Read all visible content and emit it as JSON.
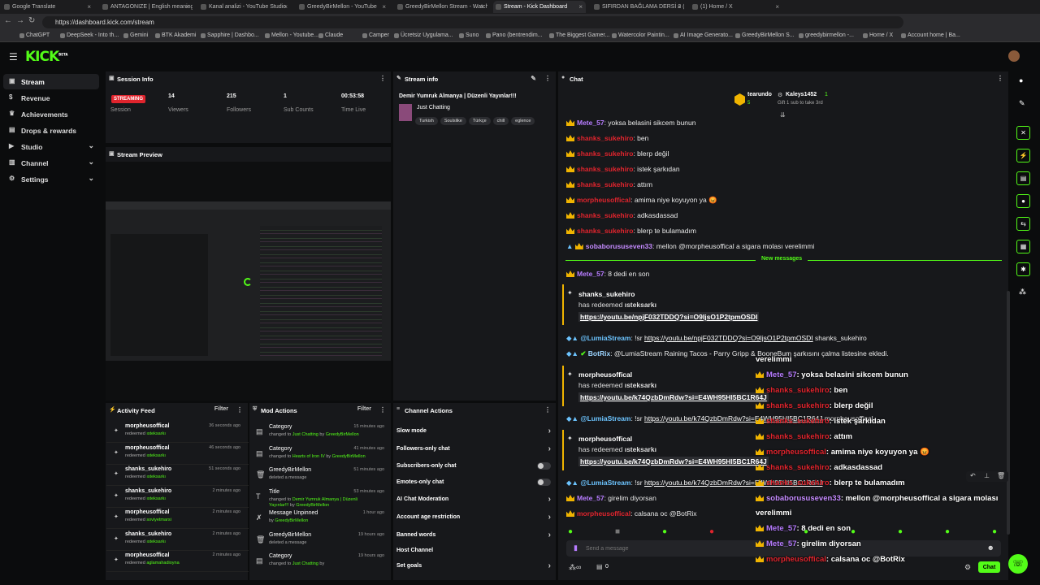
{
  "browser": {
    "tabs": [
      "Google Translate",
      "ANTAGONIZE | English meaning -",
      "Kanal analizi - YouTube Studio",
      "GreedyBirMellon - YouTube",
      "GreedyBirMellon Stream - Watch",
      "Stream - Kick Dashboard",
      "SIFIRDAN BAĞLAMA DERSİ 3 (Eh",
      "(1) Home / X"
    ],
    "url": "https://dashboard.kick.com/stream",
    "bookmarks": [
      "ChatGPT",
      "DeepSeek - Into th...",
      "Gemini",
      "BTK Akademi",
      "Sapphire | Dashbo...",
      "Mellon - Youtube...",
      "Claude",
      "Camper",
      "Ücretsiz Uygulama...",
      "Suno",
      "Pano (bentrendim...",
      "The Biggest Gamer...",
      "Watercolor Paintin...",
      "AI Image Generato...",
      "GreedyBirMellon S...",
      "greedybirmellon -...",
      "Home / X",
      "Account home | Ba..."
    ]
  },
  "logo": "KICK",
  "logo_sup": "BETA",
  "sidebar": [
    {
      "label": "Stream",
      "icon": "stream-icon"
    },
    {
      "label": "Revenue",
      "icon": "revenue-icon"
    },
    {
      "label": "Achievements",
      "icon": "trophy-icon"
    },
    {
      "label": "Drops & rewards",
      "icon": "gift-icon"
    },
    {
      "label": "Studio",
      "icon": "studio-icon"
    },
    {
      "label": "Channel",
      "icon": "channel-icon"
    },
    {
      "label": "Settings",
      "icon": "gear-icon"
    }
  ],
  "session": {
    "title": "Session Info",
    "status": "STREAMING",
    "status_label": "Session",
    "viewers": "14",
    "viewers_label": "Viewers",
    "followers": "215",
    "followers_label": "Followers",
    "subs": "1",
    "subs_label": "Sub Counts",
    "time": "00:53:58",
    "time_label": "Time Live"
  },
  "preview": {
    "title": "Stream Preview"
  },
  "streaminfo": {
    "title": "Stream info",
    "stream_title": "Demir Yumruk Almanya | Düzenli Yayınlar!!!",
    "category": "Just Chatting",
    "tags": [
      "Turkish",
      "Soulslike",
      "Türkçe",
      "chill",
      "eglence"
    ]
  },
  "activity": {
    "title": "Activity Feed",
    "filter": "Filter",
    "items": [
      {
        "user": "morpheusoffical",
        "action": "redeemed",
        "reward": "ısteksarkı",
        "time": "36 seconds ago"
      },
      {
        "user": "morpheusoffical",
        "action": "redeemed",
        "reward": "ısteksarkı",
        "time": "46 seconds ago"
      },
      {
        "user": "shanks_sukehiro",
        "action": "redeemed",
        "reward": "ısteksarkı",
        "time": "51 seconds ago"
      },
      {
        "user": "shanks_sukehiro",
        "action": "redeemed",
        "reward": "ısteksarkı",
        "time": "2 minutes ago"
      },
      {
        "user": "morpheusoffical",
        "action": "redeemed",
        "reward": "soviyetmarsi",
        "time": "2 minutes ago"
      },
      {
        "user": "shanks_sukehiro",
        "action": "redeemed",
        "reward": "ısteksarkı",
        "time": "2 minutes ago"
      },
      {
        "user": "morpheusoffical",
        "action": "redeemed",
        "reward": "aglamahadioyna",
        "time": "2 minutes ago"
      }
    ]
  },
  "mod": {
    "title": "Mod Actions",
    "filter": "Filter",
    "items": [
      {
        "head": "Category",
        "pre": "changed to",
        "val": "Just Chatting",
        "mid": "by",
        "by": "GreedyBirMellon",
        "time": "15 minutes ago",
        "icon": "category-icon"
      },
      {
        "head": "Category",
        "pre": "changed to",
        "val": "Hearts of Iron IV",
        "mid": "by",
        "by": "GreedyBirMellon",
        "time": "41 minutes ago",
        "icon": "category-icon"
      },
      {
        "head": "GreedyBirMellon",
        "pre": "deleted a message",
        "val": "",
        "mid": "",
        "by": "",
        "time": "51 minutes ago",
        "icon": "trash-icon"
      },
      {
        "head": "Title",
        "pre": "changed to",
        "val": "Demir Yumruk Almanya | Düzenli Yayınlar!!!",
        "mid": "by",
        "by": "GreedyBirMellon",
        "time": "53 minutes ago",
        "icon": "title-icon"
      },
      {
        "head": "Message Unpinned",
        "pre": "by",
        "val": "GreedyBirMellon",
        "mid": "",
        "by": "",
        "time": "1 hour ago",
        "icon": "pin-icon"
      },
      {
        "head": "GreedyBirMellon",
        "pre": "deleted a message",
        "val": "",
        "mid": "",
        "by": "",
        "time": "19 hours ago",
        "icon": "trash-icon"
      },
      {
        "head": "Category",
        "pre": "changed to",
        "val": "Just Chatting",
        "mid": "by",
        "by": "",
        "time": "19 hours ago",
        "icon": "category-icon"
      }
    ]
  },
  "channel_actions": {
    "title": "Channel Actions",
    "items": [
      "Slow mode",
      "Followers-only chat",
      "Subscribers-only chat",
      "Emotes-only chat",
      "AI Chat Moderation",
      "Account age restriction",
      "Banned words",
      "Host Channel",
      "Set goals"
    ]
  },
  "chat": {
    "title": "Chat",
    "top_gifter": "tearundo",
    "top_count": "5",
    "gifter2": "Kaleys1452",
    "gifter2_count": "1",
    "gift_note": "Gift 1 sub to take 3rd",
    "new_messages": "New messages",
    "lines": [
      {
        "u": "Mete_57",
        "c": "mgr",
        "m": ": yoksa belasini sikcem bunun"
      },
      {
        "u": "shanks_sukehiro",
        "c": "red",
        "m": ": ben"
      },
      {
        "u": "shanks_sukehiro",
        "c": "red",
        "m": ": blerp değil"
      },
      {
        "u": "shanks_sukehiro",
        "c": "red",
        "m": ": istek şarkıdan"
      },
      {
        "u": "shanks_sukehiro",
        "c": "red",
        "m": ": attım"
      },
      {
        "u": "morpheusoffical",
        "c": "red",
        "m": ": amima niye koyuyon ya 😡"
      },
      {
        "u": "shanks_sukehiro",
        "c": "red",
        "m": ": adkasdassad"
      },
      {
        "u": "shanks_sukehiro",
        "c": "red",
        "m": ": blerp te bulamadım"
      },
      {
        "u": "sobaborususeven33",
        "c": "pur",
        "m": ": mellon @morpheusoffical a sigara molası verelimmi"
      }
    ],
    "after": [
      {
        "u": "Mete_57",
        "c": "mgr",
        "m": ": 8 dedi en son"
      }
    ],
    "redeem1": {
      "user": "shanks_sukehiro",
      "text": "has redeemed",
      "reward": "ısteksarkı",
      "link": "https://youtu.be/npjF032TDDQ?si=O9IjsO1P2tpmOSDI"
    },
    "lumia1": {
      "u": "@LumiaStream",
      "pre": ": !sr ",
      "link": "https://youtu.be/npjF032TDDQ?si=O9IjsO1P2tpmOSDI",
      "post": " shanks_sukehiro"
    },
    "botrix": {
      "u": "BotRix",
      "m": ": @LumiaStream Raining Tacos - Parry Gripp & BooneBum şarkısını çalma listesine ekledi."
    },
    "redeem2": {
      "user": "morpheusoffical",
      "text": "has redeemed",
      "reward": "ısteksarkı",
      "link": "https://youtu.be/k74QzbDmRdw?si=E4WH95HI5BC1R64J"
    },
    "lumia2": {
      "u": "@LumiaStream",
      "pre": ": !sr ",
      "link": "https://youtu.be/k74QzbDmRdw?si=E4WH95HI5BC1R64J",
      "post": " morpheusoffical"
    },
    "redeem3": {
      "user": "morpheusoffical",
      "text": "has redeemed",
      "reward": "ısteksarkı",
      "link": "https://youtu.be/k74QzbDmRdw?si=E4WH95HI5BC1R64J"
    },
    "lumia3": {
      "u": "@LumiaStream",
      "pre": ": !sr ",
      "link": "https://youtu.be/k74QzbDmRdw?si=E4WH95HI5BC1R64J",
      "post": ""
    },
    "tail": [
      {
        "u": "Mete_57",
        "c": "mgr",
        "m": ": girelim diyorsan"
      },
      {
        "u": "morpheusoffical",
        "c": "red",
        "m": ": calsana oc @BotRix"
      }
    ],
    "placeholder": "Send a message",
    "user_count": "0",
    "send": "Chat"
  },
  "overlay": {
    "top": "verelimmi",
    "lines": [
      {
        "u": "Mete_57",
        "c": "mgr",
        "m": ": yoksa belasini sikcem bunun"
      },
      {
        "u": "shanks_sukehiro",
        "c": "red",
        "m": ": ben"
      },
      {
        "u": "shanks_sukehiro",
        "c": "red",
        "m": ": blerp değil"
      },
      {
        "u": "shanks_sukehiro",
        "c": "red",
        "m": ": istek şarkıdan"
      },
      {
        "u": "shanks_sukehiro",
        "c": "red",
        "m": ": attım"
      },
      {
        "u": "morpheusoffical",
        "c": "red",
        "m": ": amima niye koyuyon ya 😡"
      },
      {
        "u": "shanks_sukehiro",
        "c": "red",
        "m": ": adkasdassad"
      },
      {
        "u": "shanks_sukehiro",
        "c": "red",
        "m": ": blerp te bulamadım"
      },
      {
        "u": "sobaborususeven33",
        "c": "pur",
        "m": ": mellon @morpheusoffical a sigara molası"
      },
      {
        "u": "",
        "c": "",
        "m": "verelimmi"
      },
      {
        "u": "Mete_57",
        "c": "mgr",
        "m": ": 8 dedi en son"
      },
      {
        "u": "Mete_57",
        "c": "mgr",
        "m": ": girelim diyorsan"
      },
      {
        "u": "morpheusoffical",
        "c": "red",
        "m": ": calsana oc @BotRix"
      }
    ]
  },
  "colors": {
    "accent": "#53fc18",
    "live": "#e0242d",
    "crown": "#f0b400"
  }
}
